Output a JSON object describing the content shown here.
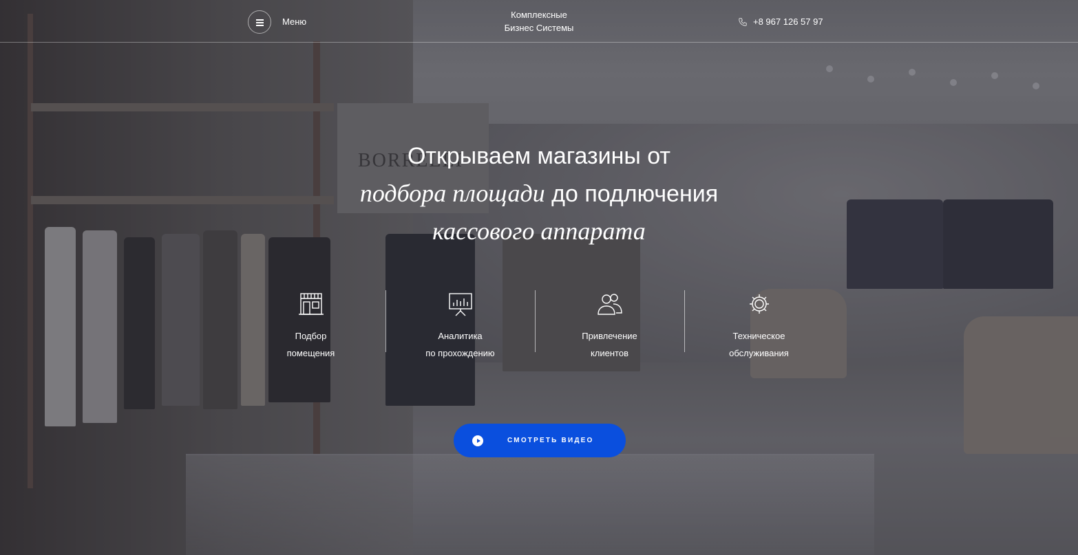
{
  "header": {
    "menu_label": "Меню",
    "brand_line1": "Комплексные",
    "brand_line2": "Бизнес Системы",
    "phone": "+8 967 126 57 97"
  },
  "hero": {
    "line1": "Открываем магазины от",
    "line2_italic": "подбора площади",
    "line2_rest": " до подлючения",
    "line3_italic": "кассового аппарата"
  },
  "features": [
    {
      "icon": "storefront-icon",
      "line1": "Подбор",
      "line2": "помещения"
    },
    {
      "icon": "presentation-chart-icon",
      "line1": "Аналитика",
      "line2": "по прохождению"
    },
    {
      "icon": "users-icon",
      "line1": "Привлечение",
      "line2": "клиентов"
    },
    {
      "icon": "gear-icon",
      "line1": "Техническое",
      "line2": "обслуживания"
    }
  ],
  "video_button": {
    "label": "СМОТРЕТЬ ВИДЕО"
  },
  "colors": {
    "accent": "#0a4fde",
    "overlay": "#282830"
  },
  "background_sign": "BORRELLI"
}
